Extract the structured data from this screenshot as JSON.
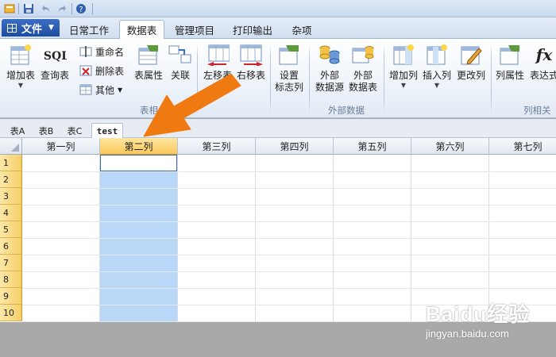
{
  "tabs": [
    {
      "label": "日常工作",
      "active": false
    },
    {
      "label": "数据表",
      "active": true
    },
    {
      "label": "管理项目",
      "active": false
    },
    {
      "label": "打印输出",
      "active": false
    },
    {
      "label": "杂项",
      "active": false
    }
  ],
  "file_button": {
    "label": "文件"
  },
  "ribbon": {
    "add_table": "增加表",
    "query_table": "查询表",
    "rename": "重命名",
    "delete_table": "删除表",
    "other": "其他",
    "table_props": "表属性",
    "relation": "关联",
    "group_table_label": "表相关",
    "move_left": "左移表",
    "move_right": "右移表",
    "set_mark_col_1": "设置",
    "set_mark_col_2": "标志列",
    "ext_source_1": "外部",
    "ext_source_2": "数据源",
    "ext_table_1": "外部",
    "ext_table_2": "数据表",
    "group_external_label": "外部数据",
    "add_col": "增加列",
    "insert_col": "插入列",
    "change_col": "更改列",
    "col_props": "列属性",
    "expression": "表达式",
    "group_col_label": "列相关"
  },
  "sheets": [
    {
      "label": "表A",
      "active": false
    },
    {
      "label": "表B",
      "active": false
    },
    {
      "label": "表C",
      "active": false
    },
    {
      "label": "test",
      "active": true
    }
  ],
  "grid": {
    "columns": [
      "第一列",
      "第二列",
      "第三列",
      "第四列",
      "第五列",
      "第六列",
      "第七列"
    ],
    "selected_column": "第二列",
    "rows": [
      "1",
      "2",
      "3",
      "4",
      "5",
      "6",
      "7",
      "8",
      "9",
      "10"
    ]
  },
  "watermark": {
    "logo": "Baidu经验",
    "url": "jingyan.baidu.com"
  },
  "colors": {
    "accent": "#1d4c9d",
    "selection": "#b9d8f8",
    "arrow": "#f07a12",
    "header_selected": "#f9c75a"
  }
}
